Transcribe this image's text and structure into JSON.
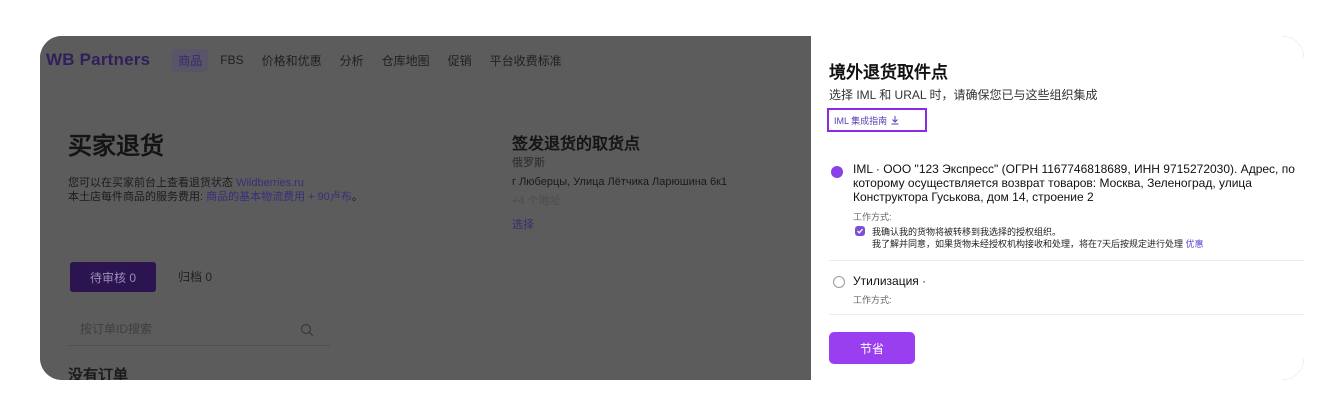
{
  "topnav": {
    "logo": "WB Partners",
    "items": [
      "商品",
      "FBS",
      "价格和优惠",
      "分析",
      "仓库地图",
      "促销",
      "平台收费标准"
    ]
  },
  "page": {
    "title": "买家退货",
    "desc_line1_prefix": "您可以在买家前台上查看退货状态 ",
    "desc_line1_link": "Wildberries.ru",
    "desc_line2_prefix": "本土店每件商品的服务费用: ",
    "desc_line2_link": "商品的基本物流费用 + 90卢布",
    "desc_line2_suffix": "。"
  },
  "return_point": {
    "title": "签发退货的取货点",
    "country": "俄罗斯",
    "address": "г Люберцы, Улица Лётчика Ларюшина 6к1",
    "more": "+4 个地址",
    "select": "选择"
  },
  "tabs": {
    "pending": "待审核 0",
    "archive": "归档 0"
  },
  "search": {
    "placeholder": "按订单ID搜索"
  },
  "empty": "没有订单",
  "panel": {
    "title": "境外退货取件点",
    "subtitle": "选择 IML 和 URAL 时，请确保您已与这些组织集成",
    "guide_label": "IML 集成指南",
    "option1": {
      "line1": "IML · ООО \"123 Экспресс\" (ОГРН 1167746818689, ИНН 9715272030). Адрес, по",
      "line2": "которому осуществляется возврат товаров: Москва, Зеленоград, улица",
      "line3": "Конструктора Гуськова, дом 14, строение 2",
      "mode_label": "工作方式:",
      "confirm_line1": "我确认我的货物将被转移到我选择的授权组织。",
      "confirm_line2_prefix": "我了解并同意，如果货物未经授权机构接收和处理，将在7天后按规定进行处理 ",
      "confirm_line2_link": "优惠"
    },
    "option2": {
      "label": "Утилизация ·",
      "mode_label": "工作方式:"
    },
    "save_label": "节省"
  },
  "colors": {
    "accent": "#9a3ff0",
    "highlight_border": "#8a2be2",
    "overlay": "#5c5c5c"
  }
}
